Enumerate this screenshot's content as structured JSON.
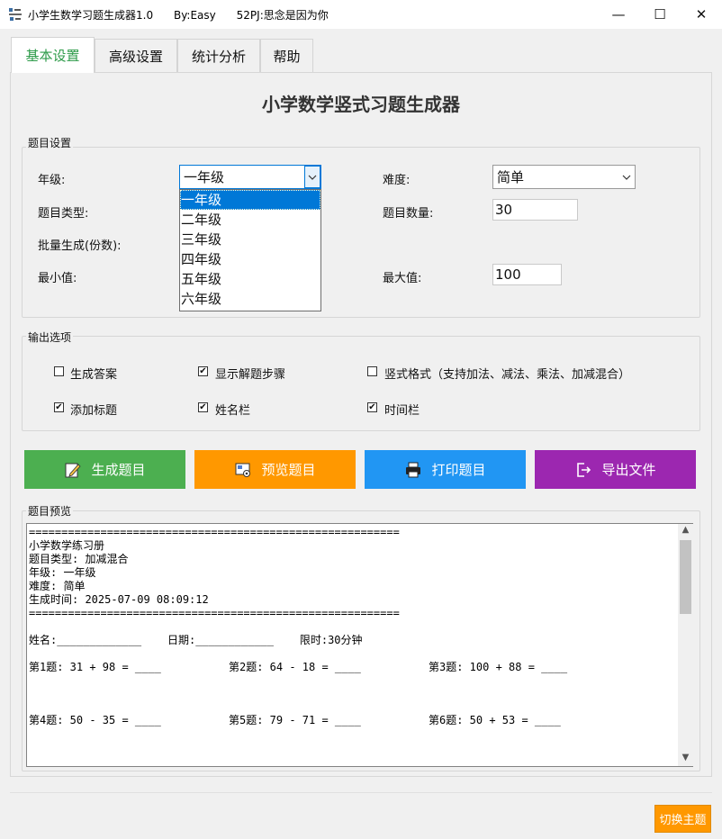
{
  "window": {
    "title": "小学生数学习题生成器1.0      By:Easy      52PJ:思念是因为你",
    "min_glyph": "—",
    "max_glyph": "☐",
    "close_glyph": "✕"
  },
  "tabs": [
    {
      "label": "基本设置",
      "active": true
    },
    {
      "label": "高级设置",
      "active": false
    },
    {
      "label": "统计分析",
      "active": false
    },
    {
      "label": "帮助",
      "active": false
    }
  ],
  "heading": "小学数学竖式习题生成器",
  "settings_group": {
    "title": "题目设置",
    "grade_label": "年级:",
    "grade_value": "一年级",
    "grade_options": [
      "一年级",
      "二年级",
      "三年级",
      "四年级",
      "五年级",
      "六年级"
    ],
    "difficulty_label": "难度:",
    "difficulty_value": "简单",
    "type_label": "题目类型:",
    "count_label": "题目数量:",
    "count_value": "30",
    "batch_label": "批量生成(份数):",
    "min_label": "最小值:",
    "max_label": "最大值:",
    "max_value": "100"
  },
  "output_group": {
    "title": "输出选项",
    "options": [
      {
        "label": "生成答案",
        "checked": false
      },
      {
        "label": "显示解题步骤",
        "checked": true
      },
      {
        "label": "竖式格式（支持加法、减法、乘法、加减混合）",
        "checked": false
      },
      {
        "label": "添加标题",
        "checked": true
      },
      {
        "label": "姓名栏",
        "checked": true
      },
      {
        "label": "时间栏",
        "checked": true
      }
    ]
  },
  "actions": {
    "generate": "生成题目",
    "preview": "预览题目",
    "print": "打印题目",
    "export": "导出文件"
  },
  "preview_group": {
    "title": "题目预览",
    "lines": [
      "=========================================================",
      "小学数学练习册",
      "题目类型: 加减混合",
      "年级: 一年级",
      "难度: 简单",
      "生成时间: 2025-07-09 08:09:12",
      "========================================================="
    ],
    "info_line": "姓名:_____________    日期:____________    限时:30分钟",
    "problems": [
      [
        "第1题: 31 + 98 = ____",
        "第2题: 64 - 18 = ____",
        "第3题: 100 + 88 = ____"
      ],
      [
        "第4题: 50 - 35 = ____",
        "第5题: 79 - 71 = ____",
        "第6题: 50 + 53 = ____"
      ]
    ]
  },
  "footer": {
    "theme_button": "切换主题"
  },
  "colors": {
    "generate": "#4caf50",
    "preview": "#ff9800",
    "print": "#2196f3",
    "export": "#9c27b0",
    "active_tab": "#2e9b4a",
    "selection": "#0078d7"
  }
}
